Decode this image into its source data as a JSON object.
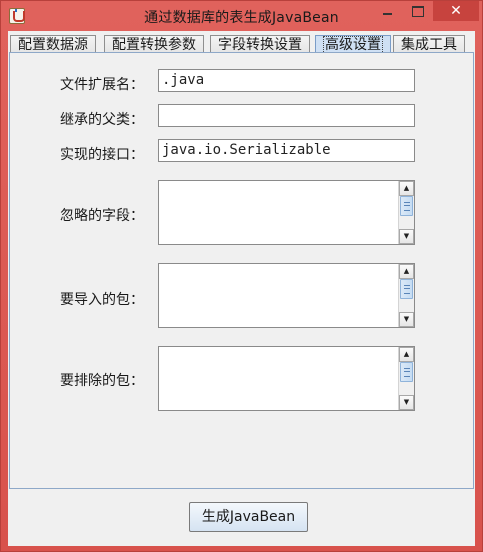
{
  "window": {
    "title": "通过数据库的表生成JavaBean",
    "close_glyph": "✕"
  },
  "tabs": [
    {
      "label": "配置数据源",
      "selected": false
    },
    {
      "label": "配置转换参数",
      "selected": false
    },
    {
      "label": "字段转换设置",
      "selected": false
    },
    {
      "label": "高级设置",
      "selected": true
    },
    {
      "label": "集成工具",
      "selected": false
    }
  ],
  "form": {
    "file_extension": {
      "label": "文件扩展名：",
      "value": ".java"
    },
    "parent_class": {
      "label": "继承的父类：",
      "value": ""
    },
    "interfaces": {
      "label": "实现的接口：",
      "value": "java.io.Serializable"
    },
    "ignored_fields": {
      "label": "忽略的字段：",
      "value": ""
    },
    "import_packages": {
      "label": "要导入的包：",
      "value": ""
    },
    "exclude_packages": {
      "label": "要排除的包：",
      "value": ""
    }
  },
  "scrollbar": {
    "up_glyph": "▲",
    "down_glyph": "▼"
  },
  "actions": {
    "generate_label": "生成JavaBean"
  },
  "colors": {
    "titlebar": "#d8524c",
    "tab_selected": "#cfe0f4",
    "panel_border": "#8ea8c8",
    "button_gradient_end": "#d5e3f2"
  }
}
